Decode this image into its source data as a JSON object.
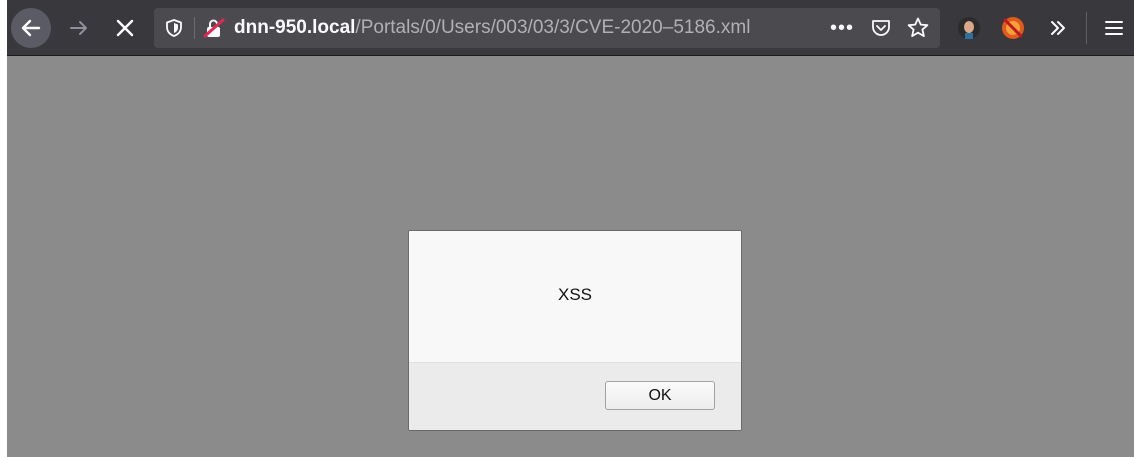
{
  "browser": {
    "url": {
      "host": "dnn-950.local",
      "path": "/Portals/0/Users/003/03/3/CVE-2020–5186.xml"
    },
    "page_actions_label": "•••",
    "icons": {
      "back": "back-arrow-icon",
      "forward": "forward-arrow-icon",
      "stop": "close-icon",
      "tracking": "shield-icon",
      "security": "insecure-lock-icon",
      "pocket": "pocket-icon",
      "bookmark": "star-icon",
      "extension1": "avatar-extension-icon",
      "extension2": "blocked-extension-icon",
      "overflow": "chevron-double-right-icon",
      "menu": "hamburger-menu-icon"
    }
  },
  "alert": {
    "message": "XSS",
    "ok_label": "OK"
  },
  "colors": {
    "toolbar": "#38383d",
    "urlbar": "#4a4a4f",
    "page_overlay": "#8b8b8b",
    "dialog_body": "#f8f8f8",
    "dialog_footer": "#ebebeb"
  }
}
